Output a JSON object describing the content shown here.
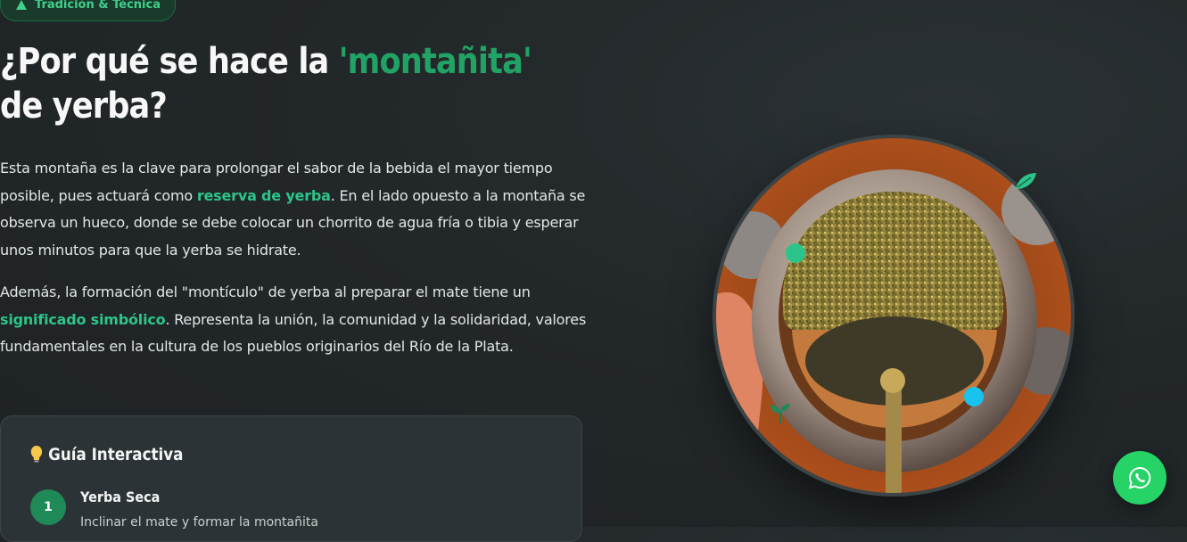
{
  "badge": {
    "label": "Tradición & Técnica",
    "icon": "mountain-icon"
  },
  "heading": {
    "before": "¿Por qué se hace la ",
    "highlight": "'montañita'",
    "after": " de yerba?"
  },
  "paragraph1": {
    "part1": "Esta montaña es la clave para prolongar el sabor de la bebida el mayor tiempo posible, pues actuará como ",
    "emphasis": "reserva de yerba",
    "part2": ". En el lado opuesto a la montaña se observa un hueco, donde se debe colocar un chorrito de agua fría o tibia y esperar unos minutos para que la yerba se hidrate."
  },
  "paragraph2": {
    "part1": "Además, la formación del \"montículo\" de yerba al preparar el mate tiene un ",
    "emphasis": "significado simbólico",
    "part2": ". Representa la unión, la comunidad y la solidaridad, valores fundamentales en la cultura de los pueblos originarios del Río de la Plata."
  },
  "guide": {
    "title": "Guía Interactiva",
    "icon": "lightbulb-icon",
    "steps": [
      {
        "number": "1",
        "title": "Yerba Seca",
        "description": "Inclinar el mate y formar la montañita"
      }
    ]
  },
  "image": {
    "subject": "mate-with-yerba-mountain"
  },
  "whatsapp": {
    "icon": "whatsapp-icon"
  },
  "colors": {
    "accent": "#22a366",
    "accent_light": "#2ec489",
    "cyan_dot": "#19c3f0",
    "green_dot": "#2bc48a",
    "whatsapp": "#25d366"
  }
}
